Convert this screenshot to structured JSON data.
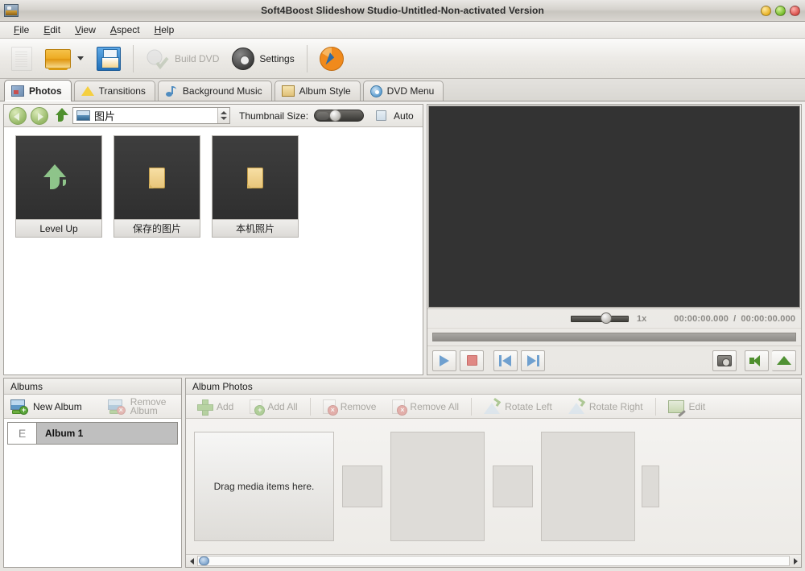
{
  "window": {
    "title": "Soft4Boost Slideshow Studio-Untitled-Non-activated Version",
    "app_icon": "app-logo-icon",
    "controls": {
      "minimize": "minimize-button",
      "maximize": "maximize-button",
      "close": "close-button"
    }
  },
  "menubar": {
    "items": [
      {
        "label": "File",
        "accel": "F"
      },
      {
        "label": "Edit",
        "accel": "E"
      },
      {
        "label": "View",
        "accel": "V"
      },
      {
        "label": "Aspect",
        "accel": "A"
      },
      {
        "label": "Help",
        "accel": "H"
      }
    ]
  },
  "toolbar": {
    "new_label": "",
    "open_label": "",
    "save_label": "",
    "build_dvd_label": "Build DVD",
    "settings_label": "Settings",
    "activate_label": ""
  },
  "tabs": [
    {
      "label": "Photos",
      "icon": "photos-icon",
      "active": true
    },
    {
      "label": "Transitions",
      "icon": "star-icon",
      "active": false
    },
    {
      "label": "Background Music",
      "icon": "music-note-icon",
      "active": false
    },
    {
      "label": "Album Style",
      "icon": "clipboard-icon",
      "active": false
    },
    {
      "label": "DVD Menu",
      "icon": "disc-icon",
      "active": false
    }
  ],
  "navbar": {
    "back": "back-arrow-icon",
    "forward": "forward-arrow-icon",
    "up": "level-up-icon",
    "path_value": "图片",
    "thumbnail_size_label": "Thumbnail Size:",
    "thumbnail_size_percent": 30,
    "auto_label": "Auto",
    "auto_checked": false
  },
  "browser": {
    "items": [
      {
        "name": "Level Up",
        "icon": "up-arrow-icon"
      },
      {
        "name": "保存的图片",
        "icon": "folder-icon"
      },
      {
        "name": "本机照片",
        "icon": "folder-icon"
      }
    ]
  },
  "preview": {
    "speed_label": "1x",
    "speed_percent": 50,
    "current_time": "00:00:00.000",
    "separator": "/",
    "total_time": "00:00:00.000",
    "seek_percent": 0,
    "buttons": {
      "play": "play-button",
      "stop": "stop-button",
      "previous": "previous-button",
      "next": "next-button",
      "snapshot": "snapshot-button",
      "volume": "volume-button",
      "eject": "eject-button"
    }
  },
  "albums_panel": {
    "header": "Albums",
    "new_album_label": "New Album",
    "remove_album_label_line1": "Remove",
    "remove_album_label_line2": "Album",
    "remove_album_enabled": false,
    "rows": [
      {
        "badge": "E",
        "name": "Album 1",
        "selected": true
      }
    ]
  },
  "album_photos_panel": {
    "header": "Album Photos",
    "buttons": [
      {
        "label": "Add",
        "icon": "plus-icon",
        "enabled": false
      },
      {
        "label": "Add All",
        "icon": "add-all-icon",
        "enabled": false
      },
      {
        "label": "Remove",
        "icon": "remove-icon",
        "enabled": false
      },
      {
        "label": "Remove All",
        "icon": "remove-all-icon",
        "enabled": false
      },
      {
        "label": "Rotate Left",
        "icon": "rotate-left-icon",
        "enabled": false
      },
      {
        "label": "Rotate Right",
        "icon": "rotate-right-icon",
        "enabled": false
      },
      {
        "label": "Edit",
        "icon": "edit-icon",
        "enabled": false
      }
    ],
    "drop_hint": "Drag media items here.",
    "scroll_position_percent": 2
  },
  "colors": {
    "titlebar_base": "#d5d2cd",
    "preview_background": "#333333",
    "thumbnail_tile": "#3a3a3a",
    "selection": "#bfbfbf",
    "accent_green": "#7aa83c",
    "accent_blue": "#6fa0cf",
    "accent_orange": "#edab24",
    "disabled_text": "#a9a7a2"
  }
}
